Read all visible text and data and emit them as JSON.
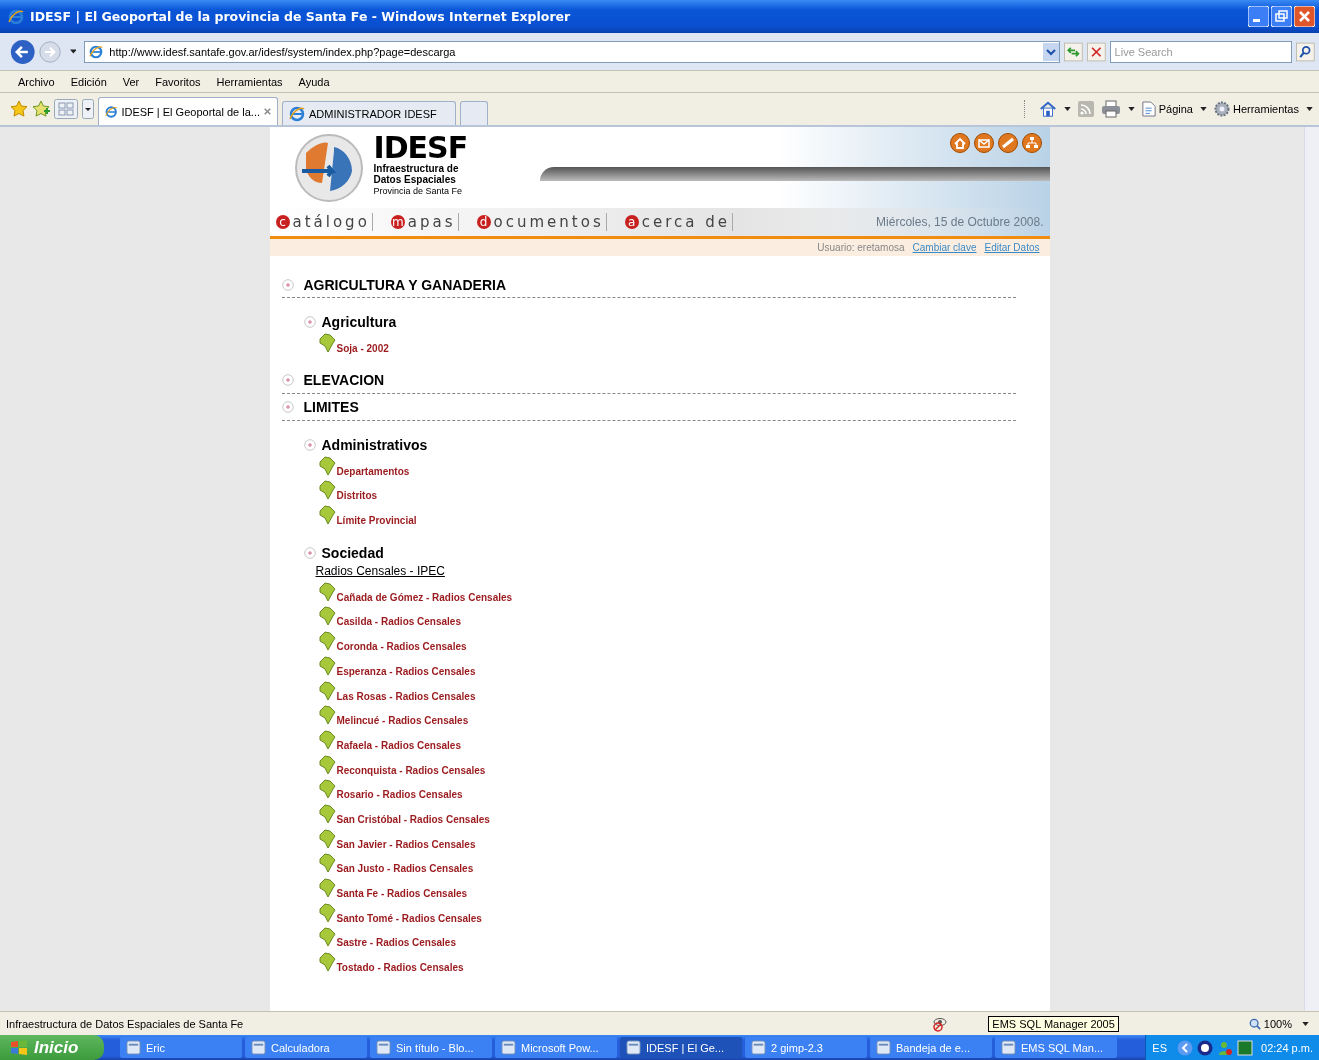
{
  "window": {
    "title": "IDESF | El Geoportal de la provincia de Santa Fe - Windows Internet Explorer"
  },
  "address_bar": {
    "url": "http://www.idesf.santafe.gov.ar/idesf/system/index.php?page=descarga",
    "search_placeholder": "Live Search"
  },
  "menu": [
    "Archivo",
    "Edición",
    "Ver",
    "Favoritos",
    "Herramientas",
    "Ayuda"
  ],
  "tabs": [
    {
      "label": "IDESF | El Geoportal de la...",
      "selected": true
    },
    {
      "label": "ADMINISTRADOR IDESF",
      "selected": false
    }
  ],
  "command_bar": {
    "page_label": "Página",
    "tools_label": "Herramientas"
  },
  "page": {
    "logo": {
      "title": "IDESF",
      "line1": "Infraestructura de",
      "line2": "Datos Espaciales",
      "line3": "Provincia de Santa Fe"
    },
    "nav": [
      {
        "initial": "c",
        "rest": "atálogo"
      },
      {
        "initial": "m",
        "rest": "apas"
      },
      {
        "initial": "d",
        "rest": "ocumentos"
      },
      {
        "initial": "a",
        "rest": "cerca de"
      }
    ],
    "date": "Miércoles, 15 de Octubre 2008.",
    "user": "Usuario: eretamosa",
    "user_links": [
      "Cambiar clave",
      "Editar Datos"
    ],
    "categories": [
      {
        "title": "AGRICULTURA Y GANADERIA",
        "groups": [
          {
            "title": "Agricultura",
            "items": [
              "Soja - 2002"
            ]
          }
        ]
      },
      {
        "title": "ELEVACION"
      },
      {
        "title": "LIMITES",
        "groups": [
          {
            "title": "Administrativos",
            "items": [
              "Departamentos",
              "Distritos",
              "Límite Provincial"
            ]
          },
          {
            "title": "Sociedad",
            "link": "Radios Censales - IPEC",
            "items": [
              "Cañada de Gómez - Radios Censales",
              "Casilda - Radios Censales",
              "Coronda - Radios Censales",
              "Esperanza - Radios Censales",
              "Las Rosas - Radios Censales",
              "Melincué - Radios Censales",
              "Rafaela - Radios Censales",
              "Reconquista - Radios Censales",
              "Rosario - Radios Censales",
              "San Cristóbal - Radios Censales",
              "San Javier - Radios Censales",
              "San Justo - Radios Censales",
              "Santa Fe - Radios Censales",
              "Santo Tomé - Radios Censales",
              "Sastre - Radios Censales",
              "Tostado - Radios Censales"
            ]
          }
        ]
      }
    ]
  },
  "status_bar": {
    "text": "Infraestructura de Datos Espaciales de Santa Fe",
    "zoom": "100%",
    "tooltip": "EMS SQL Manager 2005"
  },
  "taskbar": {
    "start": "Inicio",
    "buttons": [
      {
        "label": "Eric",
        "selected": false
      },
      {
        "label": "Calculadora",
        "selected": false
      },
      {
        "label": "Sin título - Blo...",
        "selected": false
      },
      {
        "label": "Microsoft Pow...",
        "selected": false
      },
      {
        "label": "IDESF | El Ge...",
        "selected": true
      },
      {
        "label": "2  gimp-2.3",
        "selected": false
      },
      {
        "label": "Bandeja de e...",
        "selected": false
      },
      {
        "label": "EMS SQL Man...",
        "selected": false
      }
    ],
    "language": "ES",
    "clock": "02:24 p.m."
  }
}
